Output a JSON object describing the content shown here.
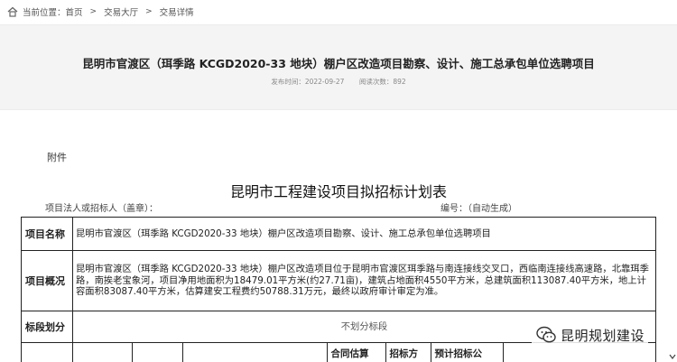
{
  "breadcrumb": {
    "home_icon": "home-icon",
    "items": [
      "当前位置：首页",
      "交易大厅",
      "交易详情"
    ],
    "separator": ">"
  },
  "header": {
    "title": "昆明市官渡区（珥季路 KCGD2020-33 地块）棚户区改造项目勘察、设计、施工总承包单位选聘项目",
    "publish_time": "发布时间：2022-09-27",
    "view_count": "阅读次数：892"
  },
  "attachment": {
    "label": "附件"
  },
  "document": {
    "title": "昆明市工程建设项目拟招标计划表",
    "legal_person": "项目法人或招标人（盖章）：",
    "number": "编号：（自动生成）"
  },
  "table": {
    "rows": [
      {
        "label": "项目名称",
        "value": "昆明市官渡区（珥季路 KCGD2020-33 地块）棚户区改造项目勘察、设计、施工总承包单位选聘项目"
      },
      {
        "label": "项目概况",
        "value": "昆明市官渡区（珥季路 KCGD2020-33 地块）棚户区改造项目位于昆明市官渡区珥季路与南连接线交叉口，西临南连接线高速路，北靠珥季路，南挨老宝象河，项目净用地面积为18479.01平方米(约27.71亩)，建筑占地面积4550平方米，总建筑面积113087.40平方米，地上计容面积83087.40平方米，估算建安工程费约50788.31万元，最终以政府审计审定为准。"
      },
      {
        "label": "标段划分",
        "value": "不划分标段"
      }
    ],
    "partial_headers": [
      "",
      "",
      "",
      "",
      "合同估算",
      "招标方",
      "预计招标公",
      ""
    ]
  },
  "watermark": {
    "icon": "wechat-icon",
    "text": "昆明规划建设"
  },
  "scroll": {
    "icon": "arrow-down-icon"
  }
}
